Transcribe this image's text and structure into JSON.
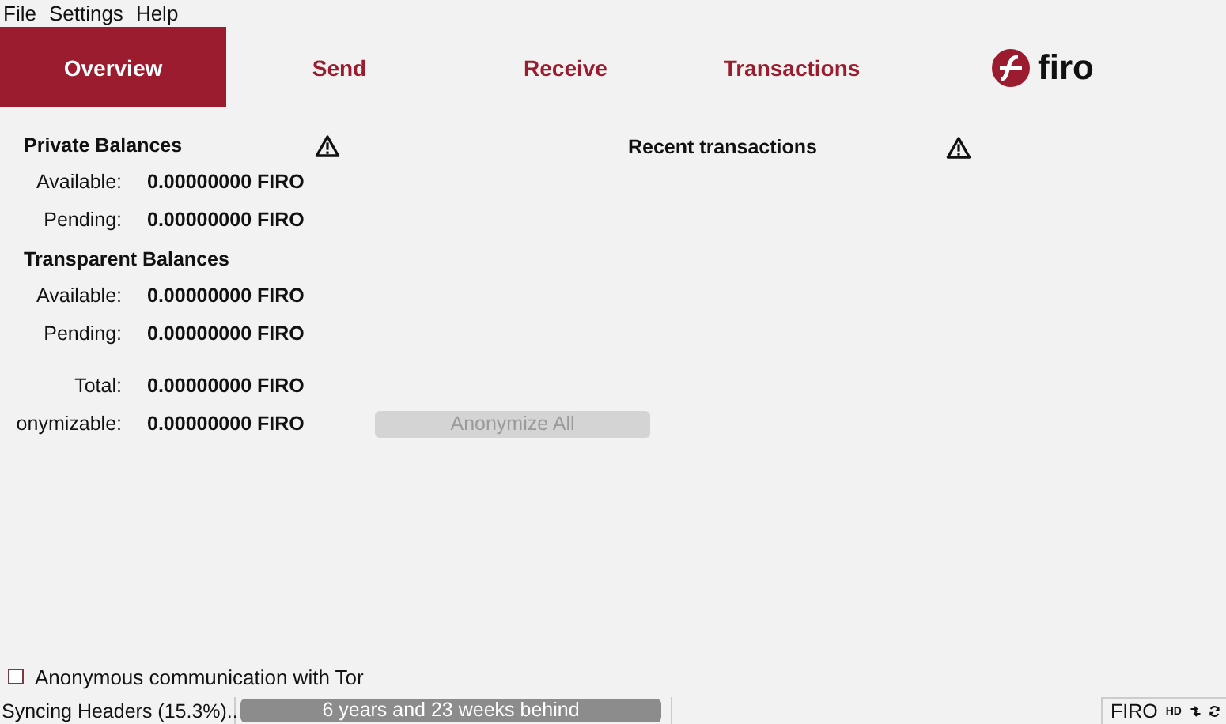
{
  "menu": [
    "File",
    "Settings",
    "Help"
  ],
  "tabs": [
    {
      "label": "Overview",
      "selected": true
    },
    {
      "label": "Send",
      "selected": false
    },
    {
      "label": "Receive",
      "selected": false
    },
    {
      "label": "Transactions",
      "selected": false
    }
  ],
  "logo": {
    "text": "firo"
  },
  "private_balances": {
    "title": "Private Balances",
    "rows": [
      {
        "label": "Available:",
        "value": "0.00000000 FIRO"
      },
      {
        "label": "Pending:",
        "value": "0.00000000 FIRO"
      }
    ]
  },
  "transparent_balances": {
    "title": "Transparent Balances",
    "rows": [
      {
        "label": "Available:",
        "value": "0.00000000 FIRO"
      },
      {
        "label": "Pending:",
        "value": "0.00000000 FIRO"
      }
    ]
  },
  "totals": [
    {
      "label": "Total:",
      "value": "0.00000000 FIRO"
    },
    {
      "label": "onymizable:",
      "value": "0.00000000 FIRO"
    }
  ],
  "anonymize_button": {
    "label": "Anonymize All",
    "disabled": true
  },
  "recent_transactions": {
    "title": "Recent transactions"
  },
  "tor_checkbox": {
    "label": "Anonymous communication with Tor",
    "checked": false
  },
  "status_bar": {
    "sync_text": "Syncing Headers (15.3%)...",
    "progress": {
      "text": "6 years and 23 weeks behind",
      "level": 1
    },
    "unit": "FIRO",
    "hd_label": "HD"
  }
}
